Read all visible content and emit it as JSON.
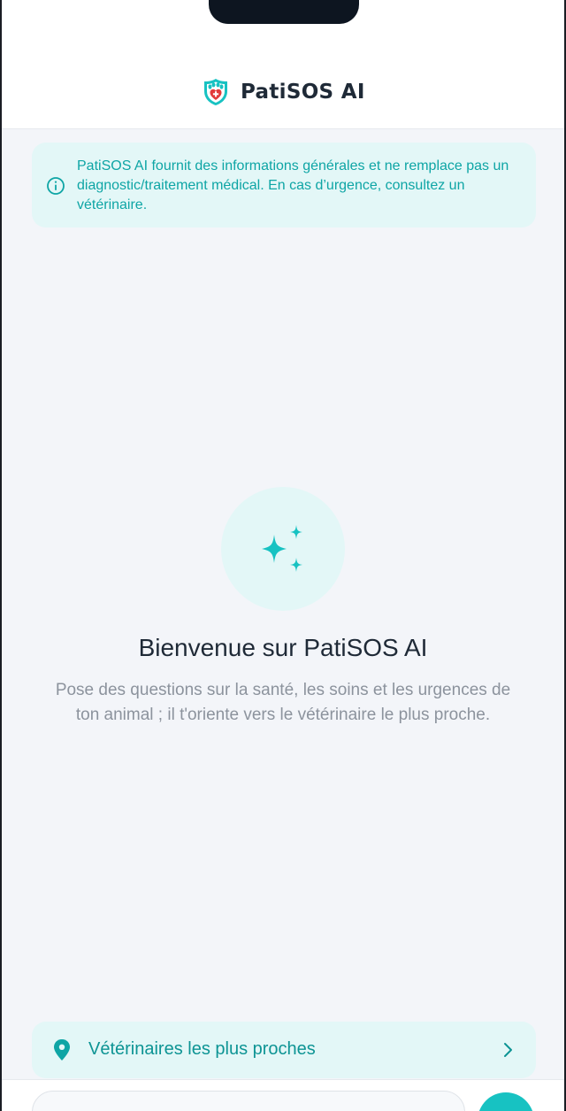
{
  "app": {
    "name": "PatiSOS AI",
    "logo_icon": "paw-heart-shield-icon"
  },
  "disclaimer": {
    "icon": "info-icon",
    "text": "PatiSOS AI fournit des informations générales et ne remplace pas un diagnostic/traitement médical. En cas d’urgence, consultez un vétérinaire."
  },
  "welcome": {
    "icon": "sparkles-icon",
    "title": "Bienvenue sur PatiSOS AI",
    "subtitle": "Pose des questions sur la santé, les soins et les urgences de ton animal ; il t'oriente vers le vétérinaire le plus proche."
  },
  "nearest_vets": {
    "icon": "location-pin-icon",
    "label": "Vétérinaires les plus proches",
    "chevron": "chevron-right-icon"
  },
  "composer": {
    "input_value": "",
    "send_icon": "send-icon"
  },
  "colors": {
    "accent": "#17c2c2",
    "accent_text": "#0ea5a5",
    "accent_soft": "#e3f7f7",
    "logo_red": "#e23b3b",
    "title": "#1f2a37",
    "muted": "#8c939d",
    "background": "#f3f5f9"
  }
}
